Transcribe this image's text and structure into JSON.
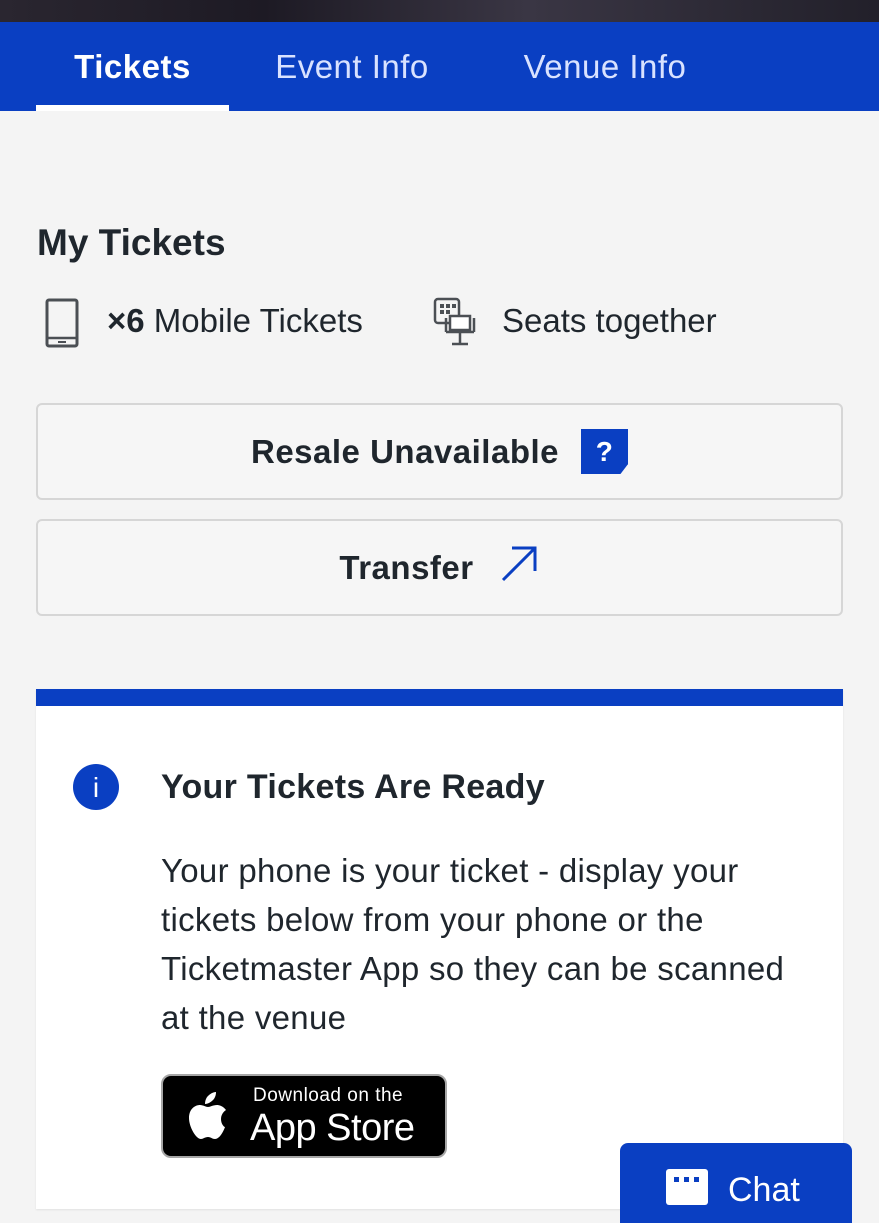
{
  "tabs": [
    {
      "label": "Tickets",
      "active": true
    },
    {
      "label": "Event Info",
      "active": false
    },
    {
      "label": "Venue Info",
      "active": false
    }
  ],
  "my_tickets": {
    "title": "My Tickets",
    "quantity": "×6",
    "ticket_type": "Mobile Tickets",
    "seating": "Seats together"
  },
  "buttons": {
    "resale": "Resale Unavailable",
    "help": "?",
    "transfer": "Transfer"
  },
  "notice": {
    "icon_letter": "i",
    "title": "Your Tickets Are Ready",
    "body": "Your phone is your ticket - display your tickets below from your phone or the Ticketmaster App so they can be scanned at the venue"
  },
  "app_store": {
    "line1": "Download on the",
    "line2": "App Store"
  },
  "chat": {
    "label": "Chat"
  },
  "colors": {
    "brand_blue": "#0a3fc2",
    "background": "#f4f4f4",
    "text": "#1f262d"
  },
  "icons": [
    "mobile-phone-icon",
    "seats-together-icon",
    "help-icon",
    "transfer-arrow-icon",
    "info-icon",
    "apple-logo-icon",
    "chat-icon"
  ]
}
